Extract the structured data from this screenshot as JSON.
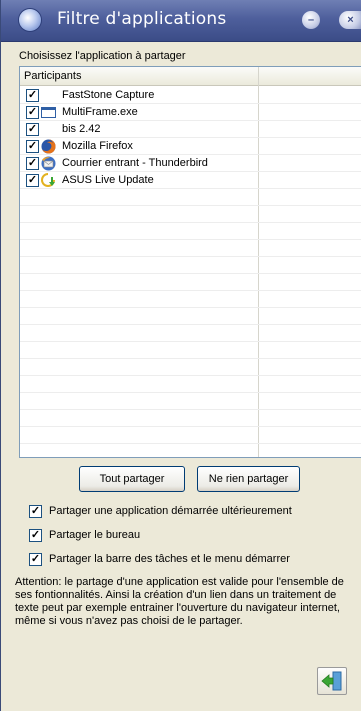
{
  "window": {
    "title": "Filtre d'applications",
    "minimize_glyph": "–",
    "close_glyph": "×"
  },
  "chooser": {
    "label": "Choisissez l'application à partager",
    "column_header": "Participants",
    "checkmark": "✓",
    "rows": [
      {
        "label": "FastStone Capture",
        "checked": true,
        "icon": "none"
      },
      {
        "label": "MultiFrame.exe",
        "checked": true,
        "icon": "window-icon"
      },
      {
        "label": "bis 2.42",
        "checked": true,
        "icon": "none"
      },
      {
        "label": "Mozilla Firefox",
        "checked": true,
        "icon": "firefox-icon"
      },
      {
        "label": "Courrier entrant - Thunderbird",
        "checked": true,
        "icon": "thunderbird-icon"
      },
      {
        "label": "ASUS Live Update",
        "checked": true,
        "icon": "asus-update-icon"
      }
    ]
  },
  "buttons": {
    "share_all": "Tout partager",
    "share_none": "Ne rien partager"
  },
  "options": [
    {
      "label": "Partager une application démarrée ultérieurement",
      "checked": true
    },
    {
      "label": "Partager le bureau",
      "checked": true
    },
    {
      "label": "Partager la barre des tâches et le menu démarrer",
      "checked": true
    }
  ],
  "warning": "Attention: le partage d'une application est valide pour l'ensemble de ses fontionnalités. Ainsi la création d'un lien dans un traitement de texte peut par exemple entrainer l'ouverture du navigateur internet, même si vous n'avez pas choisi de le partager.",
  "colors": {
    "titlebar": "#4e5f9c",
    "window_bg": "#ece9d8",
    "list_border": "#7f9db9"
  }
}
